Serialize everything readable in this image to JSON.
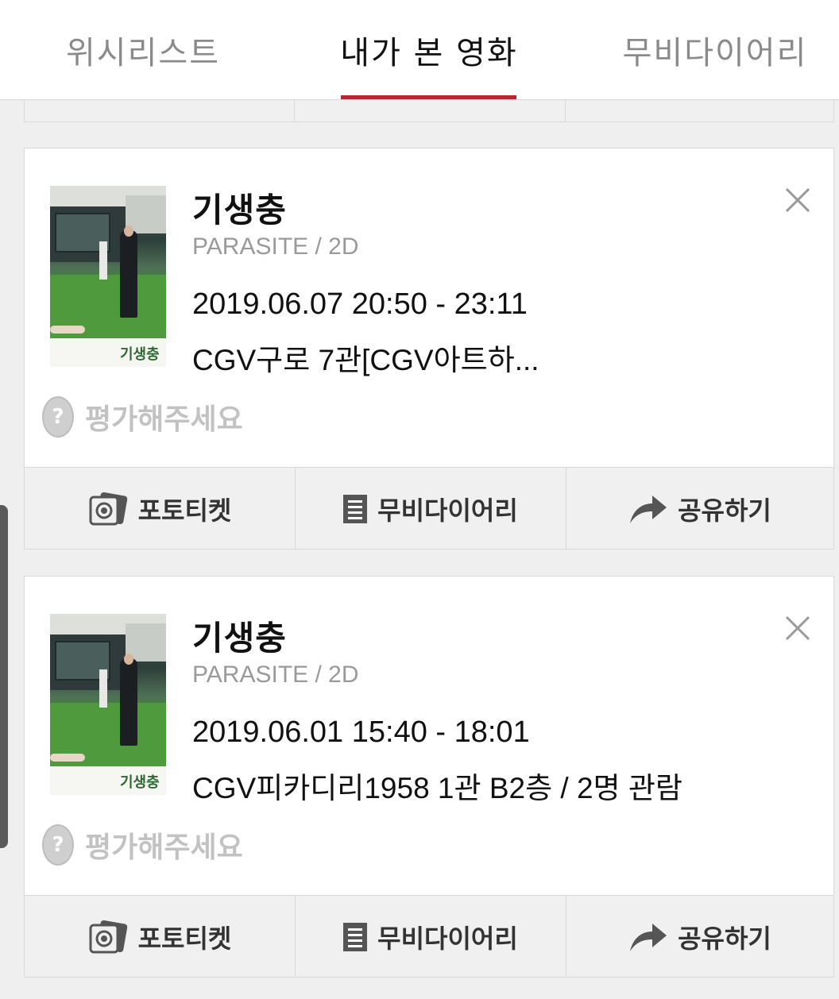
{
  "tabs": [
    {
      "label": "위시리스트",
      "active": false
    },
    {
      "label": "내가 본 영화",
      "active": true
    },
    {
      "label": "무비다이어리",
      "active": false
    }
  ],
  "accent_color": "#b7282e",
  "movies": [
    {
      "title": "기생충",
      "subtitle": "PARASITE / 2D",
      "datetime": "2019.06.07 20:50 - 23:11",
      "theater": "CGV구로 7관[CGV아트하...",
      "poster_title": "기생충",
      "rating_prompt": "평가해주세요"
    },
    {
      "title": "기생충",
      "subtitle": "PARASITE / 2D",
      "datetime": "2019.06.01 15:40 - 18:01",
      "theater": "CGV피카디리1958 1관 B2층 / 2명 관람",
      "poster_title": "기생충",
      "rating_prompt": "평가해주세요"
    }
  ],
  "actions": {
    "photo_ticket": "포토티켓",
    "movie_diary": "무비다이어리",
    "share": "공유하기"
  },
  "icons": {
    "close": "close-icon",
    "photo_ticket": "photo-ticket-icon",
    "diary": "document-icon",
    "share": "share-arrow-icon",
    "rating": "question-icon"
  }
}
